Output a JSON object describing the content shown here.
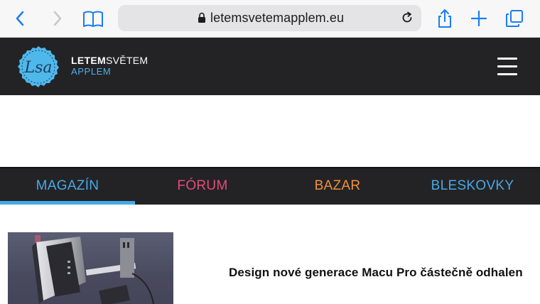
{
  "browser": {
    "url": "letemsvetemapplem.eu",
    "icons": [
      "back-icon",
      "forward-icon",
      "bookmarks-icon",
      "lock-icon",
      "reload-icon",
      "share-icon",
      "new-tab-icon",
      "tabs-icon"
    ]
  },
  "header": {
    "logo_text": "Lsa",
    "brand_bold": "LETEM",
    "brand_light": "SVĚTEM",
    "brand_sub": "APPLEM"
  },
  "colors": {
    "header_bg": "#232326",
    "accent_blue": "#47a9e6",
    "forum_pink": "#e54b77",
    "bazar_orange": "#f0913a"
  },
  "nav": {
    "tabs": [
      {
        "label": "MAGAZÍN",
        "color": "#47a9e6",
        "active": true
      },
      {
        "label": "FÓRUM",
        "color": "#e54b77",
        "active": false
      },
      {
        "label": "BAZAR",
        "color": "#f0913a",
        "active": false
      },
      {
        "label": "BLESKOVKY",
        "color": "#47a9e6",
        "active": false
      }
    ]
  },
  "article": {
    "title": "Design nové generace Macu Pro částečně odhalen"
  }
}
